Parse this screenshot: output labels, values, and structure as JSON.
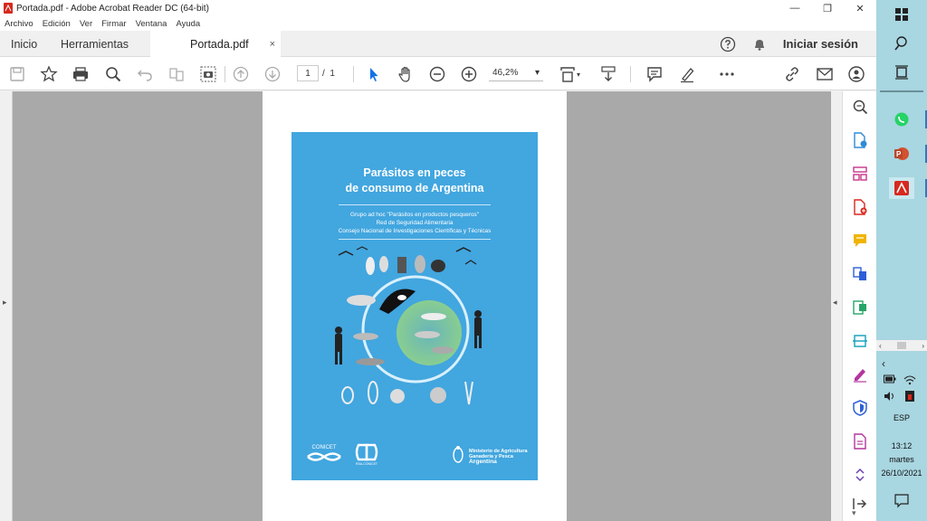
{
  "window": {
    "title": "Portada.pdf - Adobe Acrobat Reader DC (64-bit)",
    "controls": {
      "minimize": "—",
      "restore": "❐",
      "close": "✕"
    }
  },
  "menu": [
    "Archivo",
    "Edición",
    "Ver",
    "Firmar",
    "Ventana",
    "Ayuda"
  ],
  "tabs": {
    "home": "Inicio",
    "tools": "Herramientas",
    "document": "Portada.pdf",
    "close": "×",
    "signin": "Iniciar sesión"
  },
  "toolbar": {
    "page_current": "1",
    "page_separator": "/",
    "page_total": "1",
    "zoom_value": "46,2%",
    "zoom_arrow": "▾"
  },
  "cover": {
    "title_line1": "Parásitos en peces",
    "title_line2": "de consumo de Argentina",
    "subtitle_line1": "Grupo ad hoc \"Parásitos en productos pesqueros\"",
    "subtitle_line2": "Red de Seguridad Alimentaria",
    "subtitle_line3": "Consejo Nacional de Investigaciones Científicas y Técnicas",
    "logo_conicet": "CONICET",
    "logo_red": "RSA-CONICET",
    "ministry_line1": "Ministerio de Agricultura",
    "ministry_line2": "Ganadería y Pesca",
    "ministry_line3": "Argentina"
  },
  "side_arrows": {
    "left": "▸",
    "right": "◂",
    "bottom": "▾"
  },
  "taskbar": {
    "language": "ESP",
    "time": "13:12",
    "day": "martes",
    "date": "26/10/2021",
    "scroll_left": "‹",
    "scroll_right": "›",
    "chevron": "‹"
  },
  "colors": {
    "accent": "#1473e6",
    "cover_blue": "#42a6df",
    "pdf_red": "#d7281e",
    "taskbar": "#a8d6e1",
    "doc_bg": "#a9a9a9"
  },
  "icons": {
    "toolbar": [
      "save-icon",
      "bookmark-star-icon",
      "print-icon",
      "search-zoom-icon",
      "undo-icon",
      "organize-icon",
      "snapshot-icon",
      "page-up-icon",
      "page-down-icon",
      "select-cursor-icon",
      "hand-icon",
      "zoom-out-icon",
      "zoom-in-icon",
      "fit-page-icon",
      "scroll-mode-icon",
      "comment-icon",
      "highlight-pen-icon",
      "more-icon",
      "share-link-icon",
      "email-icon",
      "add-user-icon"
    ],
    "tools_pane": [
      "search-zoom-icon",
      "export-pdf-icon",
      "organize-pages-icon",
      "create-pdf-icon",
      "comment-icon",
      "combine-files-icon",
      "compress-icon",
      "scan-ocr-icon",
      "fill-sign-icon",
      "protect-icon",
      "edit-pdf-icon",
      "expand-icon",
      "collapse-pane-icon"
    ]
  }
}
